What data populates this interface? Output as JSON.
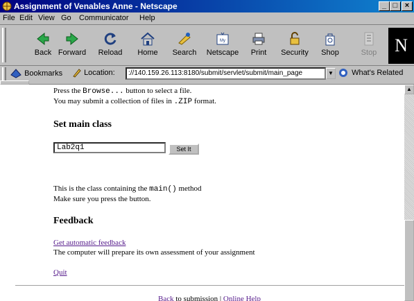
{
  "window": {
    "title": "Assignment of Venables Anne - Netscape"
  },
  "menu": [
    "File",
    "Edit",
    "View",
    "Go",
    "Communicator",
    "Help"
  ],
  "toolbar": [
    "Back",
    "Forward",
    "Reload",
    "Home",
    "Search",
    "Netscape",
    "Print",
    "Security",
    "Shop",
    "Stop"
  ],
  "location": {
    "bookmarks_label": "Bookmarks",
    "label": "Location:",
    "url": "://140.159.26.113:8180/submit/servlet/submit/main_page",
    "whats_related": "What's Related"
  },
  "page": {
    "browse_pre": "Press the ",
    "browse_code": "Browse...",
    "browse_post": " button to select a file.",
    "zip_pre": "You may submit a collection of files in ",
    "zip_code": ".ZIP",
    "zip_post": " format.",
    "main_class_heading": "Set main class",
    "class_value": "Lab2q1",
    "set_button": "Set It",
    "method_pre": "This is the class containing the ",
    "method_code": "main()",
    "method_post": " method",
    "press_note": "Make sure you press the button.",
    "feedback_heading": "Feedback",
    "feedback_link": "Get automatic feedback",
    "feedback_desc": "The computer will prepare its own assessment of your assignment",
    "quit_link": "Quit",
    "footer_back": "Back",
    "footer_mid": " to submission | ",
    "footer_help": "Online Help"
  }
}
